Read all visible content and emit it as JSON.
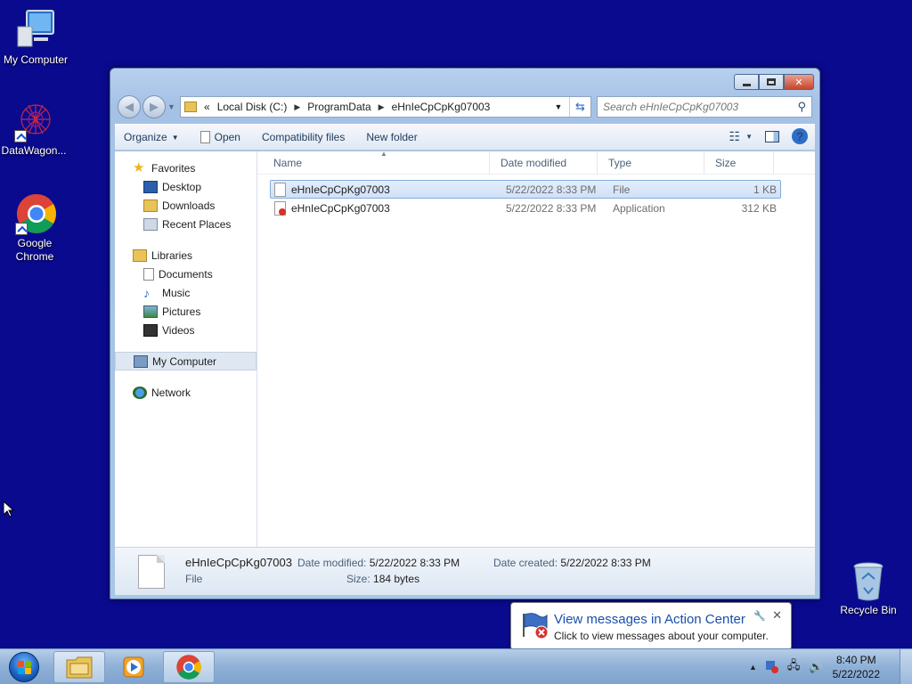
{
  "desktop": {
    "icons": [
      {
        "label": "My Computer"
      },
      {
        "label": "DataWagon..."
      },
      {
        "label": "Google Chrome"
      },
      {
        "label": "Recycle Bin"
      }
    ]
  },
  "window": {
    "controls": {
      "minimize": "▭",
      "maximize": "▢",
      "close": "✕"
    },
    "address": {
      "prefix": "«",
      "crumbs": [
        "Local Disk (C:)",
        "ProgramData",
        "eHnIeCpCpKg07003"
      ]
    },
    "search": {
      "placeholder": "Search eHnIeCpCpKg07003"
    },
    "toolbar": {
      "organize": "Organize",
      "open": "Open",
      "compat": "Compatibility files",
      "new_folder": "New folder"
    },
    "nav": {
      "favorites": {
        "label": "Favorites",
        "items": [
          "Desktop",
          "Downloads",
          "Recent Places"
        ]
      },
      "libraries": {
        "label": "Libraries",
        "items": [
          "Documents",
          "Music",
          "Pictures",
          "Videos"
        ]
      },
      "computer": "My Computer",
      "network": "Network"
    },
    "columns": {
      "name": "Name",
      "date": "Date modified",
      "type": "Type",
      "size": "Size"
    },
    "files": [
      {
        "name": "eHnIeCpCpKg07003",
        "date": "5/22/2022 8:33 PM",
        "type": "File",
        "size": "1 KB"
      },
      {
        "name": "eHnIeCpCpKg07003",
        "date": "5/22/2022 8:33 PM",
        "type": "Application",
        "size": "312 KB"
      }
    ],
    "details": {
      "name": "eHnIeCpCpKg07003",
      "type": "File",
      "modified_label": "Date modified:",
      "modified": "5/22/2022 8:33 PM",
      "created_label": "Date created:",
      "created": "5/22/2022 8:33 PM",
      "size_label": "Size:",
      "size": "184 bytes"
    }
  },
  "balloon": {
    "title": "View messages in Action Center",
    "text": "Click to view messages about your computer."
  },
  "taskbar": {
    "time": "8:40 PM",
    "date": "5/22/2022"
  }
}
